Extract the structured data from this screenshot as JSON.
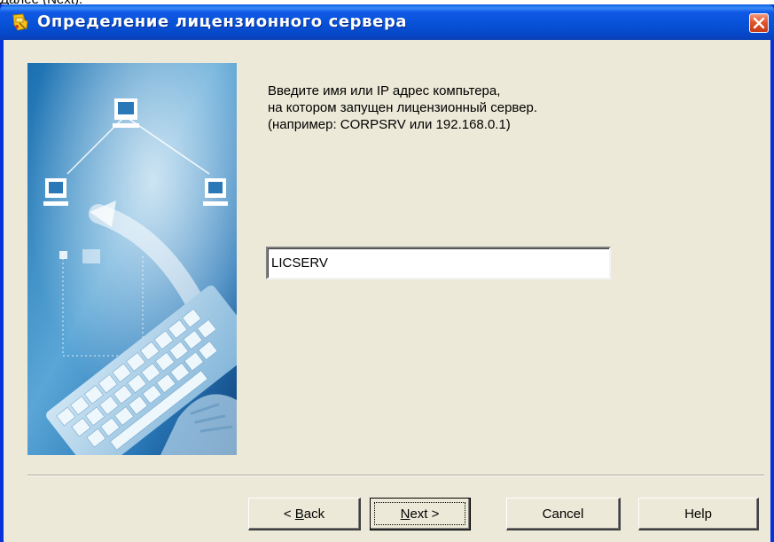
{
  "top_caption": "Далее (Next).",
  "window": {
    "title": "Определение лицензионного сервера",
    "accent_color": "#0852d8",
    "close_icon": "close-x-icon",
    "app_icon": "license-server-icon"
  },
  "instruction": {
    "line1": "Введите имя или IP адрес компьтера,",
    "line2": "на котором запущен лицензионный сервер.",
    "line3": "(например: CORPSRV или 192.168.0.1)"
  },
  "server_input": {
    "value": "LICSERV"
  },
  "buttons": {
    "back": {
      "mnemonic": "B",
      "rest": "ack",
      "prefix": "< "
    },
    "next": {
      "mnemonic": "N",
      "rest": "ext >"
    },
    "cancel": "Cancel",
    "help": "Help"
  }
}
